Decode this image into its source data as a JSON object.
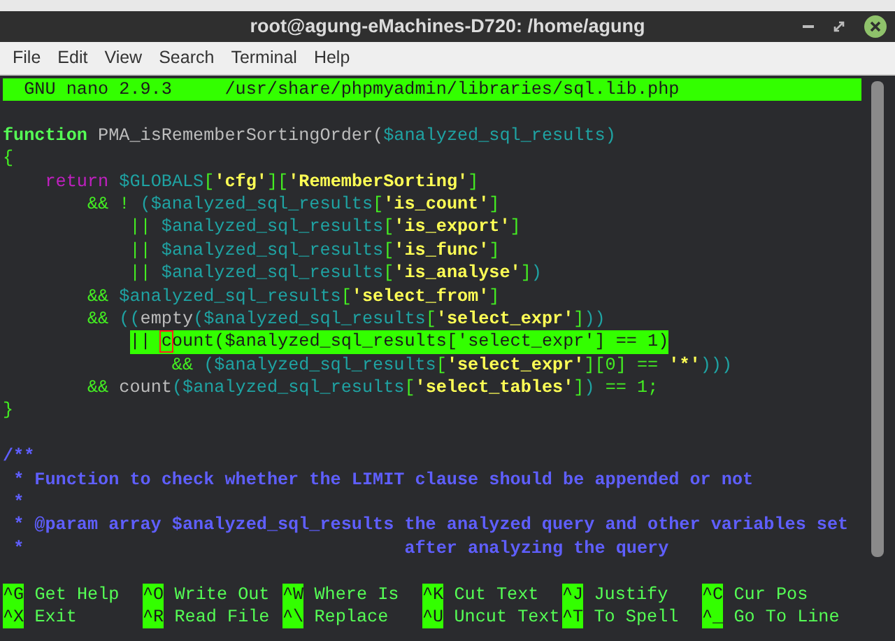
{
  "window": {
    "title": "root@agung-eMachines-D720: /home/agung"
  },
  "menu": [
    "File",
    "Edit",
    "View",
    "Search",
    "Terminal",
    "Help"
  ],
  "nano": {
    "header": "  GNU nano 2.9.3     /usr/share/phpmyadmin/libraries/sql.lib.php",
    "blocks": [
      {
        "lines": [
          {
            "highlighted": false,
            "segments": [
              {
                "s": "function",
                "color": "#55ff55",
                "bold": true
              },
              {
                "s": " PMA_isRememberSortingOrder(",
                "color": "#bdbdbd",
                "bold": false
              },
              {
                "s": "$analyzed_sql_results",
                "color": "#1fa3a3",
                "bold": false
              },
              {
                "s": ")",
                "color": "#1fa3a3",
                "bold": false
              }
            ]
          },
          {
            "highlighted": false,
            "segments": [
              {
                "s": "{",
                "color": "#44ee22",
                "bold": false
              }
            ]
          },
          {
            "highlighted": false,
            "segments": [
              {
                "s": "    return",
                "color": "#c020c0",
                "bold": false
              },
              {
                "s": " $GLOBALS",
                "color": "#1fa3a3",
                "bold": false
              },
              {
                "s": "[",
                "color": "#44ee22",
                "bold": false
              },
              {
                "s": "'cfg'",
                "color": "#ffff55",
                "bold": true
              },
              {
                "s": "][",
                "color": "#44ee22",
                "bold": false
              },
              {
                "s": "'RememberSorting'",
                "color": "#ffff55",
                "bold": true
              },
              {
                "s": "]",
                "color": "#44ee22",
                "bold": false
              }
            ]
          },
          {
            "highlighted": false,
            "segments": [
              {
                "s": "        && !",
                "color": "#44ee22",
                "bold": false
              },
              {
                "s": " ($analyzed_sql_results",
                "color": "#1fa3a3",
                "bold": false
              },
              {
                "s": "[",
                "color": "#44ee22",
                "bold": false
              },
              {
                "s": "'is_count'",
                "color": "#ffff55",
                "bold": true
              },
              {
                "s": "]",
                "color": "#44ee22",
                "bold": false
              }
            ]
          },
          {
            "highlighted": false,
            "segments": [
              {
                "s": "            ||",
                "color": "#44ee22",
                "bold": false
              },
              {
                "s": " $analyzed_sql_results",
                "color": "#1fa3a3",
                "bold": false
              },
              {
                "s": "[",
                "color": "#44ee22",
                "bold": false
              },
              {
                "s": "'is_export'",
                "color": "#ffff55",
                "bold": true
              },
              {
                "s": "]",
                "color": "#44ee22",
                "bold": false
              }
            ]
          },
          {
            "highlighted": false,
            "segments": [
              {
                "s": "            ||",
                "color": "#44ee22",
                "bold": false
              },
              {
                "s": " $analyzed_sql_results",
                "color": "#1fa3a3",
                "bold": false
              },
              {
                "s": "[",
                "color": "#44ee22",
                "bold": false
              },
              {
                "s": "'is_func'",
                "color": "#ffff55",
                "bold": true
              },
              {
                "s": "]",
                "color": "#44ee22",
                "bold": false
              }
            ]
          },
          {
            "highlighted": false,
            "segments": [
              {
                "s": "            ||",
                "color": "#44ee22",
                "bold": false
              },
              {
                "s": " $analyzed_sql_results",
                "color": "#1fa3a3",
                "bold": false
              },
              {
                "s": "[",
                "color": "#44ee22",
                "bold": false
              },
              {
                "s": "'is_analyse'",
                "color": "#ffff55",
                "bold": true
              },
              {
                "s": "]",
                "color": "#44ee22",
                "bold": false
              },
              {
                "s": ")",
                "color": "#1fa3a3",
                "bold": false
              }
            ]
          },
          {
            "highlighted": false,
            "segments": [
              {
                "s": "        &&",
                "color": "#44ee22",
                "bold": false
              },
              {
                "s": " $analyzed_sql_results",
                "color": "#1fa3a3",
                "bold": false
              },
              {
                "s": "[",
                "color": "#44ee22",
                "bold": false
              },
              {
                "s": "'select_from'",
                "color": "#ffff55",
                "bold": true
              },
              {
                "s": "]",
                "color": "#44ee22",
                "bold": false
              }
            ]
          },
          {
            "highlighted": false,
            "segments": [
              {
                "s": "        &&",
                "color": "#44ee22",
                "bold": false
              },
              {
                "s": " ((",
                "color": "#1fa3a3",
                "bold": false
              },
              {
                "s": "empty",
                "color": "#bdbdbd",
                "bold": false
              },
              {
                "s": "($analyzed_sql_results",
                "color": "#1fa3a3",
                "bold": false
              },
              {
                "s": "[",
                "color": "#44ee22",
                "bold": false
              },
              {
                "s": "'select_expr'",
                "color": "#ffff55",
                "bold": true
              },
              {
                "s": "]",
                "color": "#44ee22",
                "bold": false
              },
              {
                "s": "))",
                "color": "#1fa3a3",
                "bold": false
              }
            ]
          },
          {
            "highlighted": true,
            "segments": [
              {
                "s": "            || ",
                "color": "#1a1a1a",
                "bold": false
              },
              {
                "s": "c",
                "color": "#1a1a1a",
                "bold": false,
                "cursor": true
              },
              {
                "s": "ount($analyzed_sql_results['select_expr'] == 1)",
                "color": "#1a1a1a",
                "bold": false
              }
            ]
          },
          {
            "highlighted": false,
            "segments": [
              {
                "s": "                &&",
                "color": "#44ee22",
                "bold": false
              },
              {
                "s": " ($analyzed_sql_results",
                "color": "#1fa3a3",
                "bold": false
              },
              {
                "s": "[",
                "color": "#44ee22",
                "bold": false
              },
              {
                "s": "'select_expr'",
                "color": "#ffff55",
                "bold": true
              },
              {
                "s": "][0] == ",
                "color": "#44ee22",
                "bold": false
              },
              {
                "s": "'*'",
                "color": "#ffff55",
                "bold": true
              },
              {
                "s": ")))",
                "color": "#1fa3a3",
                "bold": false
              }
            ]
          },
          {
            "highlighted": false,
            "segments": [
              {
                "s": "        &&",
                "color": "#44ee22",
                "bold": false
              },
              {
                "s": " count",
                "color": "#bdbdbd",
                "bold": false
              },
              {
                "s": "($analyzed_sql_results",
                "color": "#1fa3a3",
                "bold": false
              },
              {
                "s": "[",
                "color": "#44ee22",
                "bold": false
              },
              {
                "s": "'select_tables'",
                "color": "#ffff55",
                "bold": true
              },
              {
                "s": "]",
                "color": "#44ee22",
                "bold": false
              },
              {
                "s": ")",
                "color": "#1fa3a3",
                "bold": false
              },
              {
                "s": " == 1;",
                "color": "#44ee22",
                "bold": false
              }
            ]
          },
          {
            "highlighted": false,
            "segments": [
              {
                "s": "}",
                "color": "#44ee22",
                "bold": false
              }
            ]
          }
        ]
      },
      {
        "lines": [
          {
            "highlighted": false,
            "segments": [
              {
                "s": "/**",
                "color": "#5f5fff",
                "bold": true
              }
            ]
          },
          {
            "highlighted": false,
            "segments": [
              {
                "s": " * Function to check whether the LIMIT clause should be appended or not",
                "color": "#5f5fff",
                "bold": true
              }
            ]
          },
          {
            "highlighted": false,
            "segments": [
              {
                "s": " *",
                "color": "#5f5fff",
                "bold": true
              }
            ]
          },
          {
            "highlighted": false,
            "segments": [
              {
                "s": " * @param array $analyzed_sql_results the analyzed query and other variables set",
                "color": "#5f5fff",
                "bold": true
              }
            ]
          },
          {
            "highlighted": false,
            "segments": [
              {
                "s": " *                                    after analyzing the query",
                "color": "#5f5fff",
                "bold": true
              }
            ]
          }
        ]
      }
    ],
    "shortcuts": [
      {
        "key": "^G",
        "label": "Get Help"
      },
      {
        "key": "^O",
        "label": "Write Out"
      },
      {
        "key": "^W",
        "label": "Where Is"
      },
      {
        "key": "^K",
        "label": "Cut Text"
      },
      {
        "key": "^J",
        "label": "Justify"
      },
      {
        "key": "^C",
        "label": "Cur Pos"
      },
      {
        "key": "^X",
        "label": "Exit"
      },
      {
        "key": "^R",
        "label": "Read File"
      },
      {
        "key": "^\\",
        "label": "Replace"
      },
      {
        "key": "^U",
        "label": "Uncut Text"
      },
      {
        "key": "^T",
        "label": "To Spell"
      },
      {
        "key": "^_",
        "label": "Go To Line"
      }
    ]
  }
}
